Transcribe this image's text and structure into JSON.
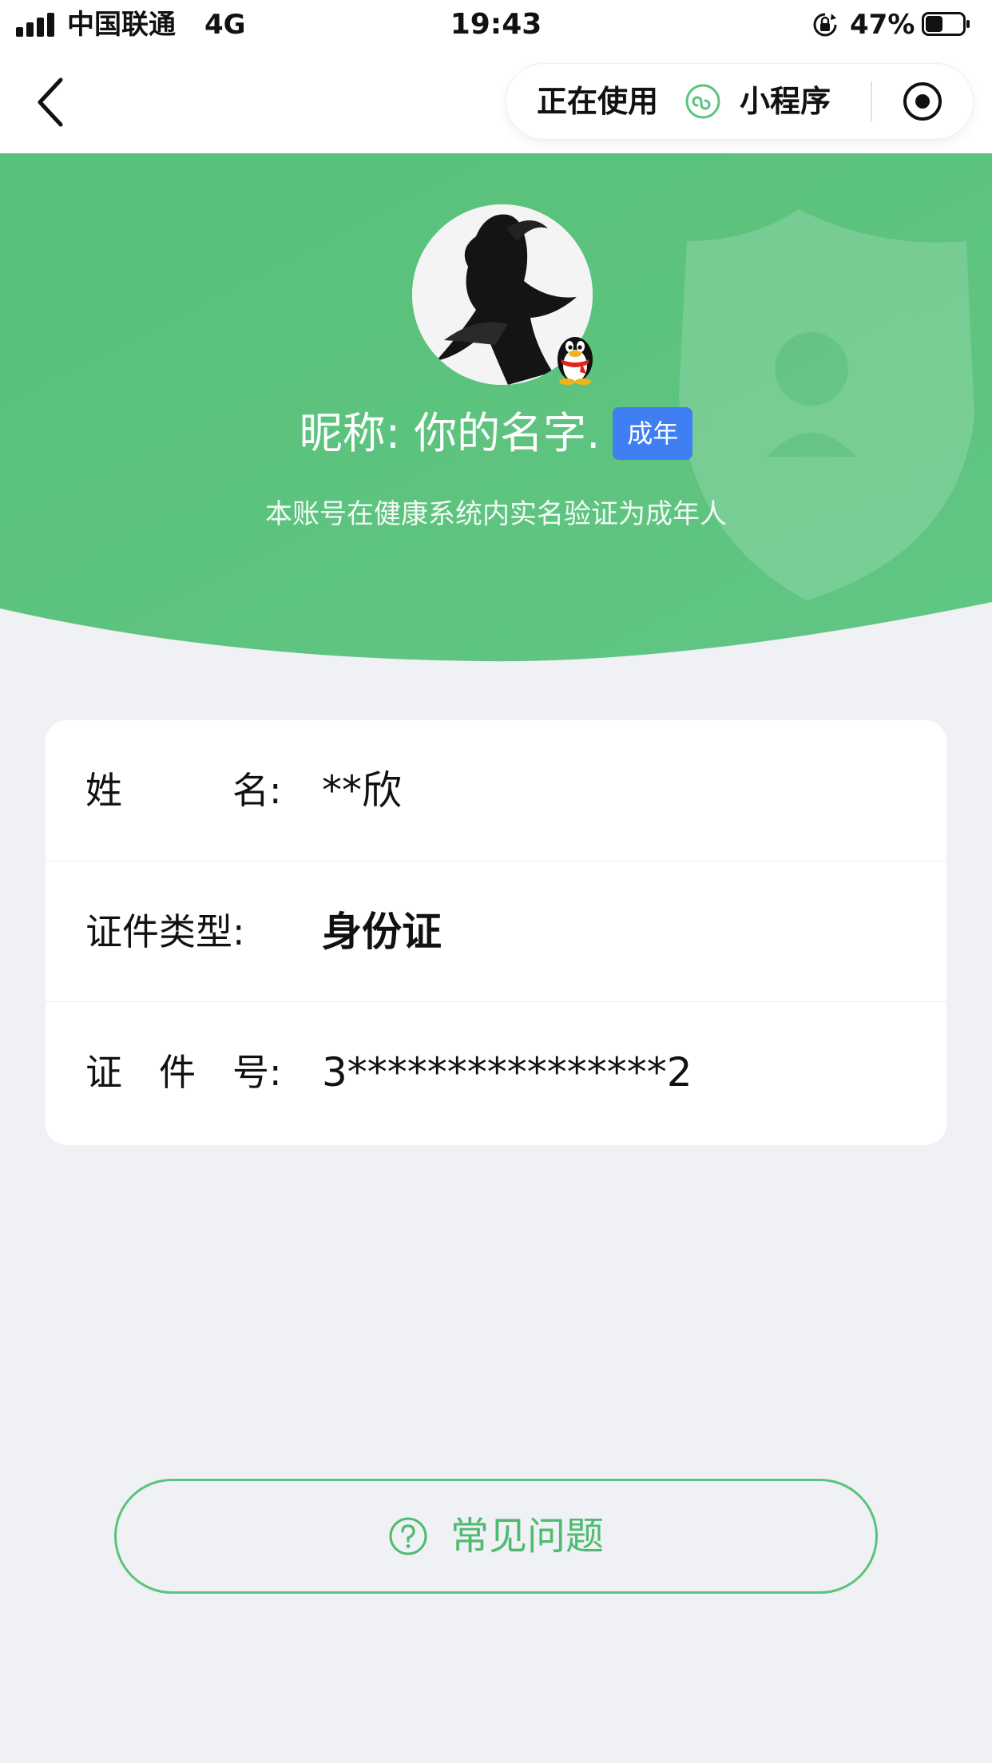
{
  "status_bar": {
    "carrier": "中国联通",
    "network": "4G",
    "time": "19:43",
    "battery_percent": "47%",
    "battery_level": 0.47,
    "icons": [
      "signal-icon",
      "rotation-lock-icon",
      "battery-icon"
    ]
  },
  "nav_bar": {
    "capsule": {
      "using_label": "正在使用",
      "mini_program_label": "小程序",
      "icons": [
        "back-arrow-icon",
        "mini-program-icon",
        "close-target-icon"
      ]
    }
  },
  "profile": {
    "nickname": "昵称: 你的名字.",
    "adult_tag": "成年",
    "verify_note": "本账号在健康系统内实名验证为成年人",
    "badge_icon": "qq-penguin-icon"
  },
  "info": {
    "rows": [
      {
        "label": "姓　　　名:",
        "value": "**欣"
      },
      {
        "label": "证件类型:",
        "value": "身份证"
      },
      {
        "label": "证　件　号:",
        "value": "3****************2"
      }
    ]
  },
  "faq": {
    "label": "常见问题",
    "icon": "question-circle-icon"
  },
  "colors": {
    "hero_green": "#5cc27c",
    "adult_tag_blue": "#3f7ef3",
    "page_background": "#eff1f4",
    "faq_green": "#4fbb6f"
  }
}
